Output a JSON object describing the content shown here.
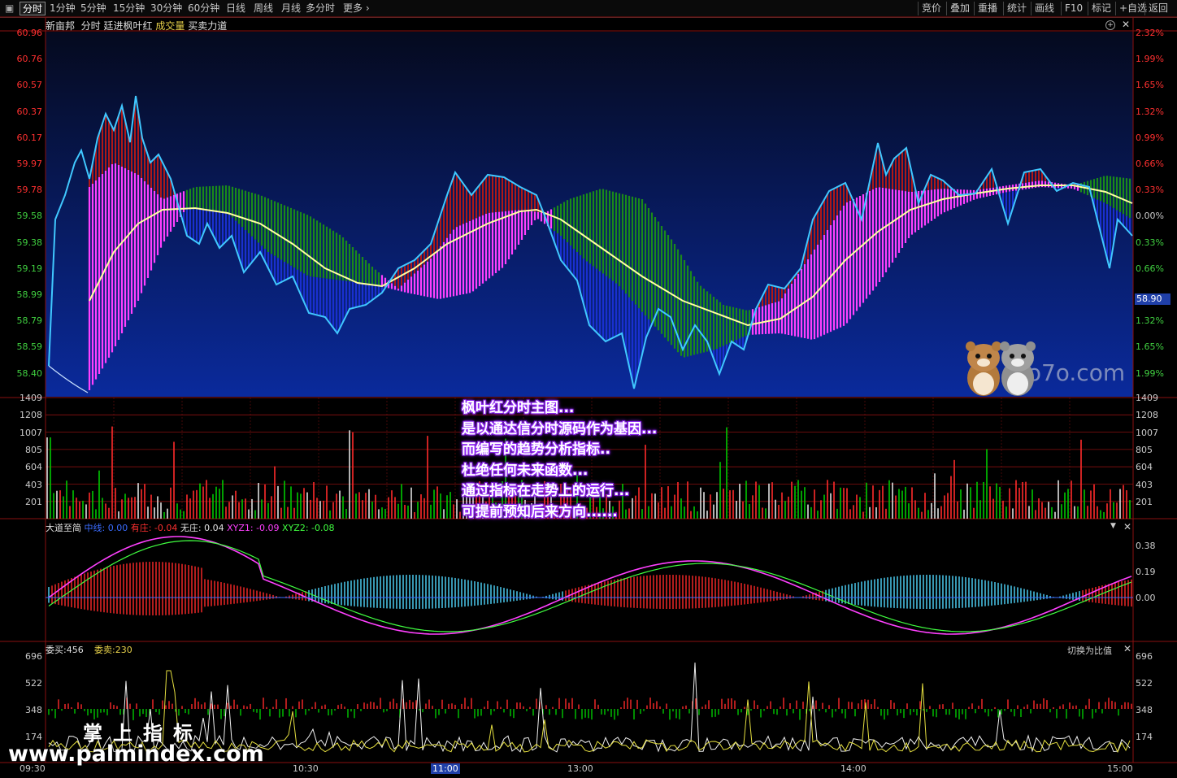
{
  "toolbar": {
    "left": [
      "分时",
      "1分钟",
      "5分钟",
      "15分钟",
      "30分钟",
      "60分钟",
      "日线",
      "周线",
      "月线",
      "多分时",
      "更多"
    ],
    "right": [
      "竞价",
      "叠加",
      "重播",
      "统计",
      "画线",
      "F10",
      "标记",
      "+自选",
      "返回"
    ],
    "active": "分时"
  },
  "header": {
    "stock": "新亩邦",
    "mode": "分时",
    "indicator": "廷进枫叶红",
    "volume": "成交量",
    "power": "买卖力道"
  },
  "main_chart": {
    "price_labels": [
      "60.96",
      "60.76",
      "60.57",
      "60.37",
      "60.17",
      "59.97",
      "59.78",
      "59.58",
      "59.38",
      "59.19",
      "58.99",
      "58.79",
      "58.59",
      "58.40"
    ],
    "pct_labels": [
      "2.32%",
      "1.99%",
      "1.65%",
      "1.32%",
      "0.99%",
      "0.66%",
      "0.33%",
      "0.00%",
      "0.33%",
      "0.66%",
      "0.99%",
      "1.32%",
      "1.65%",
      "1.99%"
    ],
    "current_price": "58.90",
    "watermark": "6o7o.com"
  },
  "volume_chart": {
    "labels": [
      "1409",
      "1208",
      "1007",
      "805",
      "604",
      "403",
      "201"
    ]
  },
  "annotation": {
    "lines": [
      "枫叶红分时主图...",
      "是以通达信分时源码作为基因...",
      "而编写的趋势分析指标..",
      "杜绝任何未来函数...",
      "通过指标在走势上的运行...",
      "可提前预知后来方向......"
    ]
  },
  "indicator_panel": {
    "name": "大道至简",
    "items": [
      {
        "label": "中线",
        "value": "0.00",
        "color": "#3a6cff"
      },
      {
        "label": "有庄",
        "value": "-0.04",
        "color": "#ff3030"
      },
      {
        "label": "无庄",
        "value": "0.04",
        "color": "#e0e0e0"
      },
      {
        "label": "XYZ1",
        "value": "-0.09",
        "color": "#ff40ff"
      },
      {
        "label": "XYZ2",
        "value": "-0.08",
        "color": "#40ff40"
      }
    ],
    "y_labels": [
      "0.38",
      "0.19",
      "0.00"
    ]
  },
  "order_panel": {
    "buy_label": "委买:456",
    "sell_label": "委卖:230",
    "switch_label": "切换为比值",
    "y_labels": [
      "696",
      "522",
      "348",
      "174"
    ]
  },
  "time_axis": [
    "09:30",
    "10:30",
    "11:00",
    "13:00",
    "14:00",
    "15:00"
  ],
  "watermark": {
    "title": "掌上指标",
    "url": "www.palmindex.com"
  },
  "colors": {
    "up": "#ff3030",
    "down": "#00c000",
    "price_line": "#40c8ff",
    "avg_line": "#ffffa0",
    "magenta": "#ff40ff",
    "green_band": "#1a8a1a",
    "grid": "#8a1010"
  }
}
